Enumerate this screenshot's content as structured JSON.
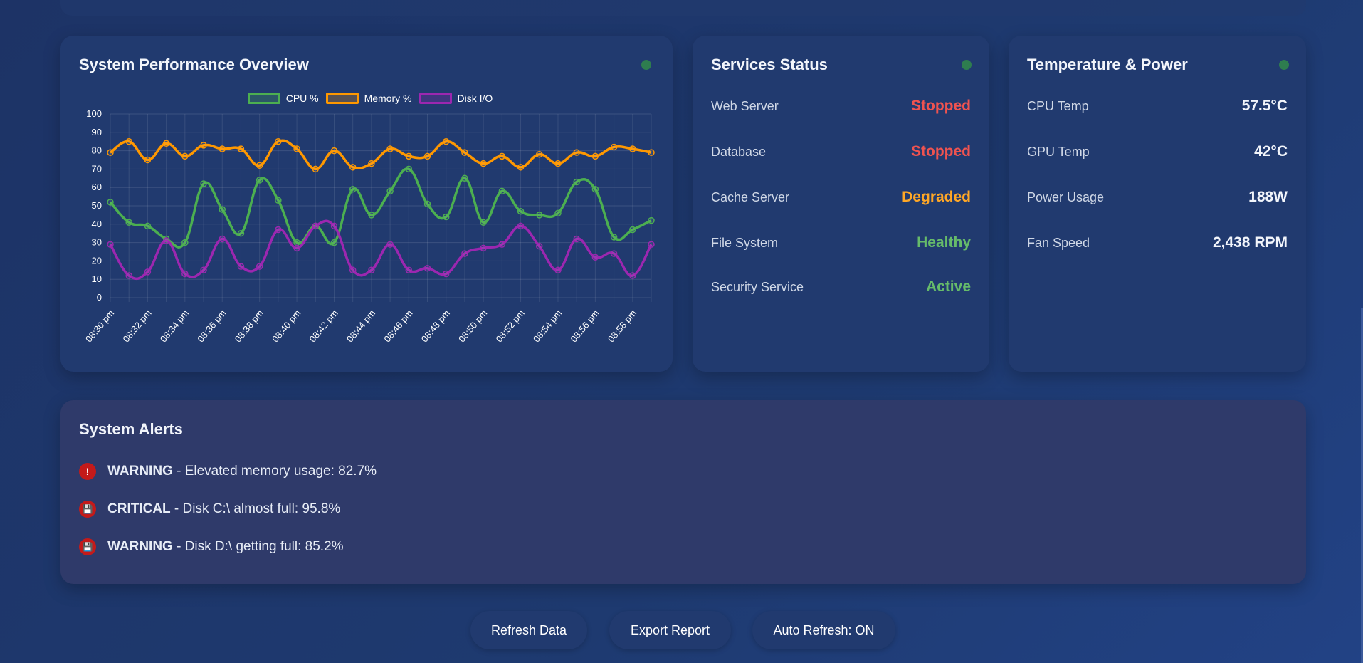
{
  "performance": {
    "title": "System Performance Overview",
    "legend": [
      "CPU %",
      "Memory %",
      "Disk I/O"
    ]
  },
  "colors": {
    "cpu": "#4caf50",
    "memory": "#ff9800",
    "disk": "#9c27b0",
    "stopped": "#ef5350",
    "degraded": "#ffa726",
    "healthy": "#66bb6a",
    "status_dot": "#2e7d4f",
    "alert_icon": "#c41a1a"
  },
  "chart_data": {
    "type": "line",
    "title": "",
    "xlabel": "",
    "ylabel": "",
    "ylim": [
      0,
      100
    ],
    "yticks": [
      0,
      10,
      20,
      30,
      40,
      50,
      60,
      70,
      80,
      90,
      100
    ],
    "grid": true,
    "legend_position": "top",
    "x_labels": [
      "08:30 pm",
      "08:32 pm",
      "08:34 pm",
      "08:36 pm",
      "08:38 pm",
      "08:40 pm",
      "08:42 pm",
      "08:44 pm",
      "08:46 pm",
      "08:48 pm",
      "08:50 pm",
      "08:52 pm",
      "08:54 pm",
      "08:56 pm",
      "08:58 pm"
    ],
    "x": [
      "08:30 pm",
      "08:31 pm",
      "08:32 pm",
      "08:33 pm",
      "08:34 pm",
      "08:35 pm",
      "08:36 pm",
      "08:37 pm",
      "08:38 pm",
      "08:39 pm",
      "08:40 pm",
      "08:41 pm",
      "08:42 pm",
      "08:43 pm",
      "08:44 pm",
      "08:45 pm",
      "08:46 pm",
      "08:47 pm",
      "08:48 pm",
      "08:49 pm",
      "08:50 pm",
      "08:51 pm",
      "08:52 pm",
      "08:53 pm",
      "08:54 pm",
      "08:55 pm",
      "08:56 pm",
      "08:57 pm",
      "08:58 pm",
      "08:59 pm"
    ],
    "series": [
      {
        "name": "CPU %",
        "values": [
          52,
          41,
          39,
          32,
          30,
          62,
          48,
          35,
          64,
          53,
          30,
          39,
          30,
          59,
          45,
          58,
          70,
          51,
          44,
          65,
          41,
          58,
          47,
          45,
          46,
          63,
          59,
          33,
          37,
          42
        ]
      },
      {
        "name": "Memory %",
        "values": [
          79,
          85,
          75,
          84,
          77,
          83,
          81,
          81,
          72,
          85,
          81,
          70,
          80,
          71,
          73,
          81,
          77,
          77,
          85,
          79,
          73,
          77,
          71,
          78,
          73,
          79,
          77,
          82,
          81,
          79
        ]
      },
      {
        "name": "Disk I/O",
        "values": [
          29,
          12,
          14,
          31,
          13,
          15,
          32,
          17,
          17,
          37,
          27,
          39,
          39,
          15,
          15,
          29,
          15,
          16,
          13,
          24,
          27,
          29,
          39,
          28,
          15,
          32,
          22,
          24,
          12,
          29
        ]
      }
    ]
  },
  "services": {
    "title": "Services Status",
    "items": [
      {
        "label": "Web Server",
        "status": "Stopped"
      },
      {
        "label": "Database",
        "status": "Stopped"
      },
      {
        "label": "Cache Server",
        "status": "Degraded"
      },
      {
        "label": "File System",
        "status": "Healthy"
      },
      {
        "label": "Security Service",
        "status": "Active"
      }
    ]
  },
  "temperature": {
    "title": "Temperature & Power",
    "items": [
      {
        "label": "CPU Temp",
        "value": "57.5°C"
      },
      {
        "label": "GPU Temp",
        "value": "42°C"
      },
      {
        "label": "Power Usage",
        "value": "188W"
      },
      {
        "label": "Fan Speed",
        "value": "2,438 RPM"
      }
    ]
  },
  "alerts": {
    "title": "System Alerts",
    "items": [
      {
        "icon": "exclamation-icon",
        "glyph": "!",
        "level": "WARNING",
        "message": " - Elevated memory usage: 82.7%"
      },
      {
        "icon": "floppy-disk-icon",
        "glyph": "💾",
        "level": "CRITICAL",
        "message": " - Disk C:\\ almost full: 95.8%"
      },
      {
        "icon": "floppy-disk-icon",
        "glyph": "💾",
        "level": "WARNING",
        "message": " - Disk D:\\ getting full: 85.2%"
      }
    ]
  },
  "buttons": {
    "refresh": "Refresh Data",
    "export": "Export Report",
    "auto_refresh": "Auto Refresh: ON"
  }
}
